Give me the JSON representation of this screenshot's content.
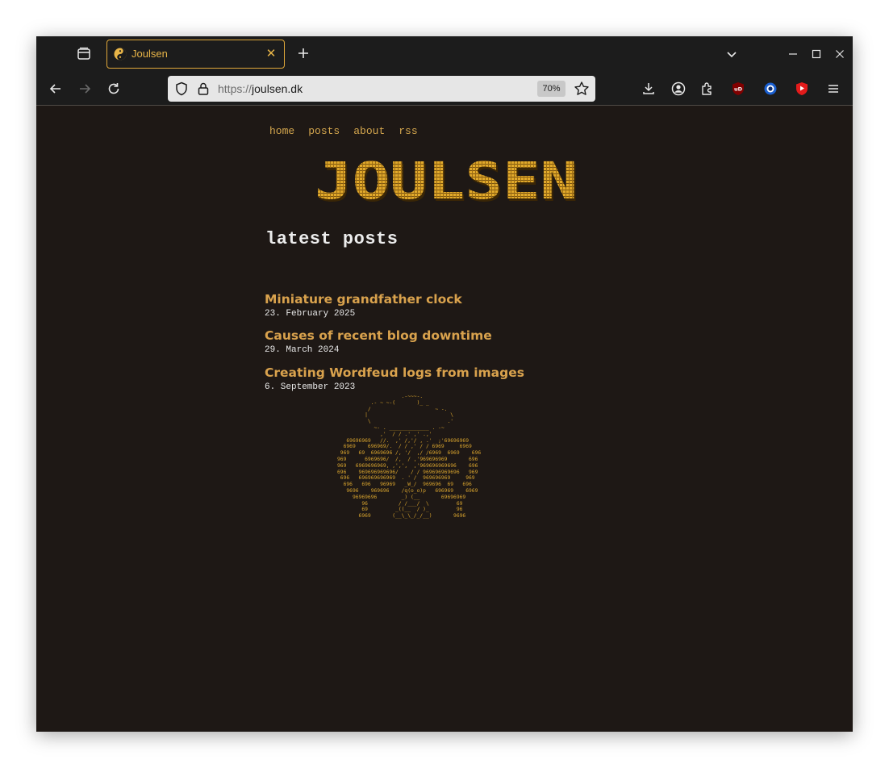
{
  "browser": {
    "tab": {
      "title": "Joulsen",
      "favicon": "yin-yang-icon"
    },
    "url": {
      "scheme": "https://",
      "host": "joulsen.dk"
    },
    "zoom": "70%",
    "colors": {
      "chrome_bg": "#1c1c1c",
      "accent": "#e0a83a"
    }
  },
  "site": {
    "nav": [
      "home",
      "posts",
      "about",
      "rss"
    ],
    "logo_text": "JOULSEN",
    "heading": "latest posts",
    "posts": [
      {
        "title": "Miniature grandfather clock",
        "date": "23. February 2025"
      },
      {
        "title": "Causes of recent blog downtime",
        "date": "29. March 2024"
      },
      {
        "title": "Creating Wordfeud logs from images",
        "date": "6. September 2023"
      }
    ],
    "ascii_art": "                     .-~~~-.\n           .- ~ ~-(       )_ _\n          /                     ~ -.\n         |                           \\\n          \\                         .'\n            ~- . _____________ . -~\n              ,'  / / .' ,' .,'\n   69696969   //.  ,' /,'/ , .'  ;'69696969\n  6969    696969/.  / / ,' / / 6969     6969\n 969   69  6969696 /, '/  ,/ /6969  6969    696\n969      6969696/  /,  / ,'969696969       696\n969   6969696969, ,',',  ,'969696969696    696\n696    969696969696/    / / 969696969696   969\n 696   696969696969  . ' /  969696969     969\n  696   696   96969   _W_/  969696  69   696\n   9696    969696    /q(o_o)p   696969    6969\n     96969696        _) (__       69696969\n        96          / /___/  \\         69\n        69         _((__  / )_         96\n       6969       (__\\_\\_/_/__)       9696",
    "colors": {
      "background": "#1e1815",
      "link": "#d9a24d",
      "ascii": "#d7a32e",
      "text": "#ececec"
    }
  }
}
